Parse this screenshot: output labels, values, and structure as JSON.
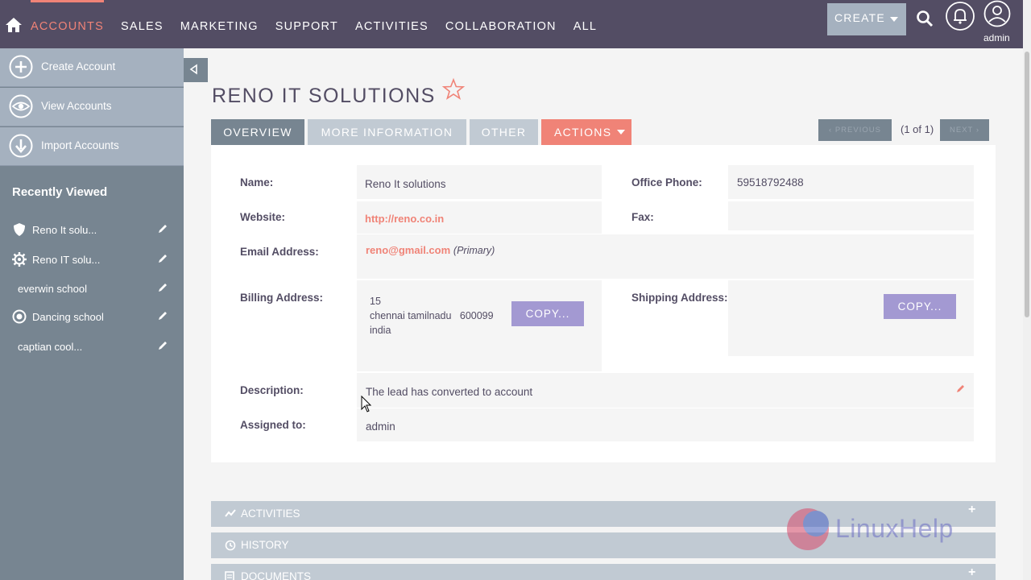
{
  "nav": {
    "items": [
      "ACCOUNTS",
      "SALES",
      "MARKETING",
      "SUPPORT",
      "ACTIVITIES",
      "COLLABORATION",
      "ALL"
    ],
    "create_label": "CREATE",
    "user_label": "admin"
  },
  "sidebar": {
    "actions": [
      {
        "label": "Create Account",
        "icon": "plus-circle-icon"
      },
      {
        "label": "View Accounts",
        "icon": "eye-icon"
      },
      {
        "label": "Import Accounts",
        "icon": "download-icon"
      }
    ],
    "recent_title": "Recently Viewed",
    "recent": [
      {
        "label": "Reno It solu...",
        "icon": "shield-icon"
      },
      {
        "label": "Reno IT solu...",
        "icon": "gear-icon"
      },
      {
        "label": "everwin school",
        "icon": ""
      },
      {
        "label": "Dancing school",
        "icon": "target-icon"
      },
      {
        "label": "captian cool...",
        "icon": ""
      }
    ]
  },
  "record": {
    "title": "RENO IT SOLUTIONS",
    "tabs": [
      "OVERVIEW",
      "MORE INFORMATION",
      "OTHER",
      "ACTIONS"
    ],
    "pager": {
      "prev": "PREVIOUS",
      "count": "(1 of 1)",
      "next": "NEXT"
    }
  },
  "fields": {
    "name_label": "Name:",
    "name_value": "Reno It solutions",
    "office_phone_label": "Office Phone:",
    "office_phone_value": "59518792488",
    "website_label": "Website:",
    "website_value": "http://reno.co.in",
    "fax_label": "Fax:",
    "email_label": "Email Address:",
    "email_value": "reno@gmail.com",
    "email_note": "(Primary)",
    "billing_label": "Billing Address:",
    "billing_lines": [
      "15",
      "chennai tamilnadu   600099",
      "india"
    ],
    "shipping_label": "Shipping Address:",
    "copy_label": "COPY...",
    "description_label": "Description:",
    "description_value": "The lead has converted to account",
    "assigned_label": "Assigned to:",
    "assigned_value": "admin"
  },
  "subpanels": [
    "ACTIVITIES",
    "HISTORY",
    "DOCUMENTS"
  ],
  "watermark": "LinuxHelp",
  "colors": {
    "nav_bg": "#534d64",
    "accent": "#f08377",
    "sidebar_bg": "#778591",
    "tab_inactive": "#c1cad3",
    "copy_button": "#a399d2"
  }
}
